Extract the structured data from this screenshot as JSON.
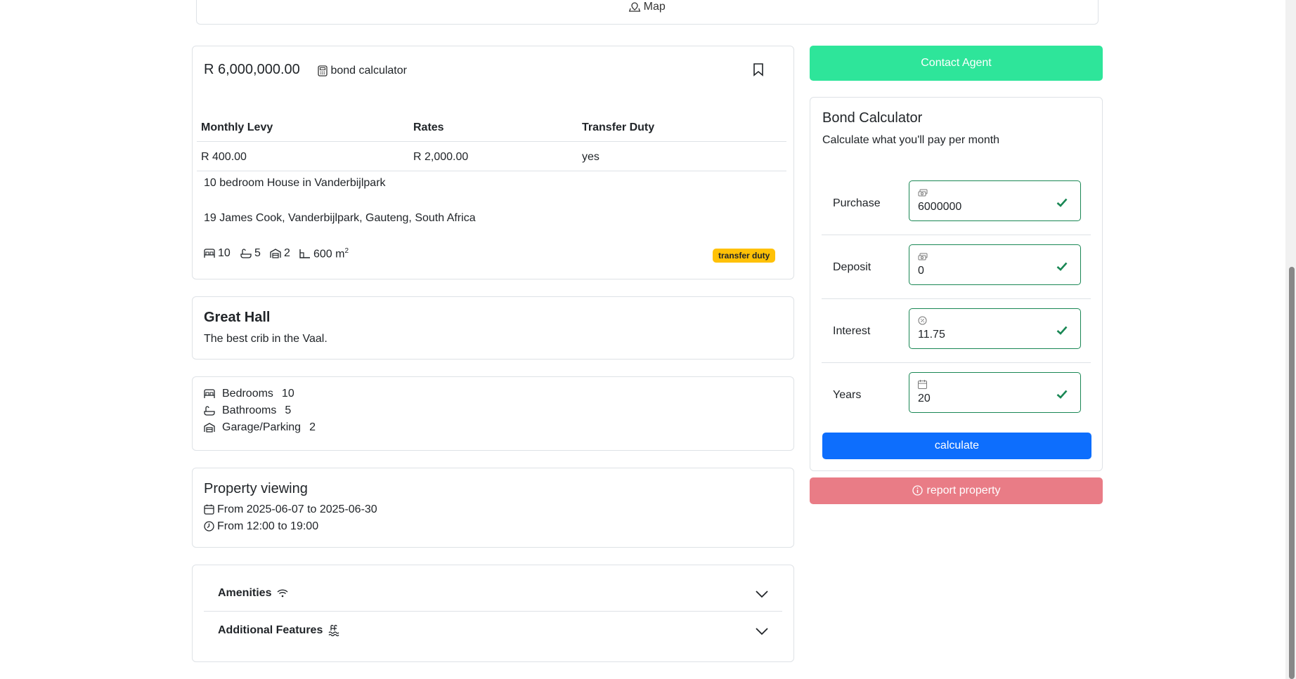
{
  "map": {
    "label": "Map",
    "icon": "map-icon"
  },
  "listing": {
    "price": "R 6,000,000.00",
    "bond_link": "bond calculator",
    "table": {
      "headers": [
        "Monthly Levy",
        "Rates",
        "Transfer Duty"
      ],
      "values": [
        "R 400.00",
        "R 2,000.00",
        "yes"
      ]
    },
    "title": "10 bedroom House in Vanderbijlpark",
    "address": "19 James Cook, Vanderbijlpark, Gauteng, South Africa",
    "features": {
      "bedrooms": "10",
      "bathrooms": "5",
      "garages": "2",
      "size": "600 m",
      "size_sup": "2"
    },
    "badge": "transfer duty"
  },
  "description": {
    "title": "Great Hall",
    "text": "The best crib in the Vaal."
  },
  "rooms": [
    {
      "label": "Bedrooms",
      "value": "10",
      "icon": "bed-icon"
    },
    {
      "label": "Bathrooms",
      "value": "5",
      "icon": "bath-icon"
    },
    {
      "label": "Garage/Parking",
      "value": "2",
      "icon": "garage-icon"
    }
  ],
  "viewing": {
    "title": "Property viewing",
    "dates": "From 2025-06-07 to 2025-06-30",
    "times": "From 12:00 to 19:00"
  },
  "accordion": {
    "amenities": "Amenities",
    "additional": "Additional Features"
  },
  "sidebar": {
    "contact": "Contact Agent",
    "calc_title": "Bond Calculator",
    "calc_sub": "Calculate what you'll pay per month",
    "fields": [
      {
        "label": "Purchase",
        "value": "6000000",
        "icon": "cash-icon"
      },
      {
        "label": "Deposit",
        "value": "0",
        "icon": "cash-icon"
      },
      {
        "label": "Interest",
        "value": "11.75",
        "icon": "percent-icon"
      },
      {
        "label": "Years",
        "value": "20",
        "icon": "calendar-icon"
      }
    ],
    "calc_button": "calculate",
    "report_button": "report property"
  },
  "colors": {
    "contact": "#2ee59a",
    "calculate": "#0d6efd",
    "report": "#e97c86",
    "badge": "#ffc107",
    "valid": "#198754"
  }
}
